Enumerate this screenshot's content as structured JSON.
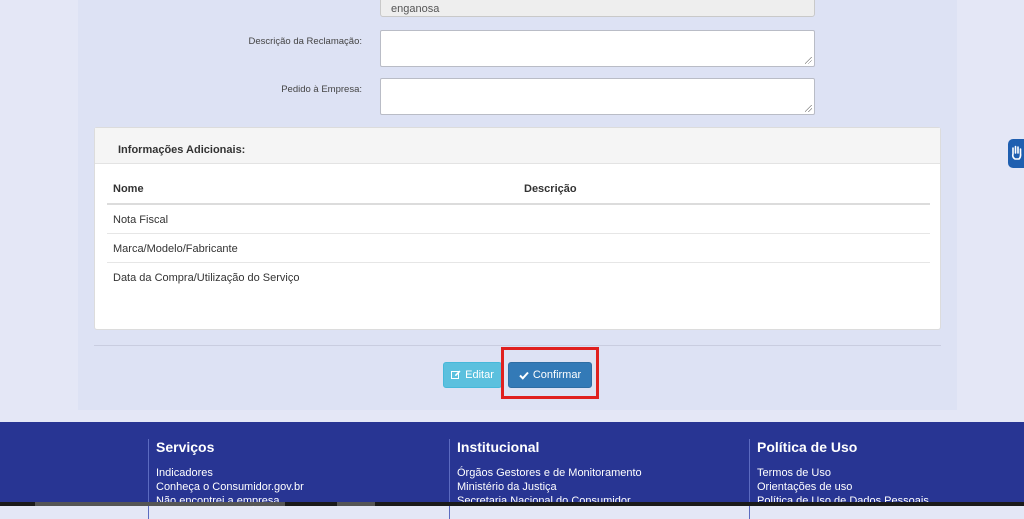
{
  "form": {
    "prev_field_value": "enganosa",
    "descricao_label": "Descrição da Reclamação:",
    "pedido_label": "Pedido à Empresa:"
  },
  "info_panel": {
    "title": "Informações Adicionais:",
    "columns": [
      "Nome",
      "Descrição"
    ],
    "rows": [
      {
        "nome": "Nota Fiscal",
        "descricao": ""
      },
      {
        "nome": "Marca/Modelo/Fabricante",
        "descricao": ""
      },
      {
        "nome": "Data da Compra/Utilização do Serviço",
        "descricao": ""
      }
    ]
  },
  "actions": {
    "editar_label": "Editar",
    "editar_icon": "edit-icon",
    "confirmar_label": "Confirmar",
    "confirmar_icon": "check-icon"
  },
  "footer": {
    "servicos": {
      "title": "Serviços",
      "links": [
        "Indicadores",
        "Conheça o Consumidor.gov.br",
        "Não encontrei a empresa"
      ]
    },
    "institucional": {
      "title": "Institucional",
      "links": [
        "Órgãos Gestores e de Monitoramento",
        "Ministério da Justiça",
        "Secretaria Nacional do Consumidor"
      ]
    },
    "politica": {
      "title": "Política de Uso",
      "links": [
        "Termos de Uso",
        "Orientações de uso",
        "Política de Uso de Dados Pessoais"
      ]
    }
  },
  "colors": {
    "primary": "#337ab7",
    "info": "#5bc0de",
    "footer": "#283593",
    "highlight": "#e0201f"
  },
  "accessibility_widget_icon": "hand-icon"
}
